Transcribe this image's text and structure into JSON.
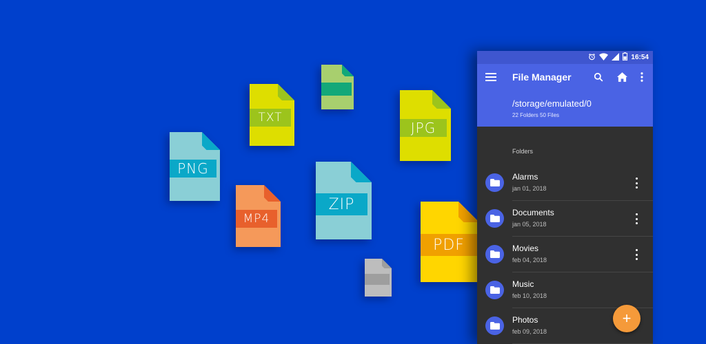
{
  "background_color": "#0040cc",
  "file_icons": [
    {
      "label": "PNG",
      "sheet": "#8acfd6",
      "accent": "#0aa8c8"
    },
    {
      "label": "TXT",
      "sheet": "#dede00",
      "accent": "#9cc41c"
    },
    {
      "label": "",
      "sheet": "#a8cf6e",
      "accent": "#13a879"
    },
    {
      "label": "JPG",
      "sheet": "#dede00",
      "accent": "#9cc41c"
    },
    {
      "label": "MP4",
      "sheet": "#f5995a",
      "accent": "#e8602c"
    },
    {
      "label": "ZIP",
      "sheet": "#8acfd6",
      "accent": "#0aa8c8"
    },
    {
      "label": "PDF",
      "sheet": "#ffd600",
      "accent": "#f0a000"
    },
    {
      "label": "",
      "sheet": "#bdbdbd",
      "accent": "#9e9e9e"
    }
  ],
  "status_bar": {
    "icons": [
      "alarm-icon",
      "wifi-icon",
      "signal-icon",
      "battery-icon"
    ],
    "time": "16:54"
  },
  "app_bar": {
    "title": "File Manager",
    "actions": [
      "search-icon",
      "home-icon",
      "more-vert-icon"
    ],
    "path": "/storage/emulated/0",
    "summary": "22 Folders 50 Files",
    "color": "#4a63e4"
  },
  "list": {
    "section_label": "Folders",
    "items": [
      {
        "name": "Alarms",
        "date": "jan 01, 2018",
        "has_menu": true
      },
      {
        "name": "Documents",
        "date": "jan 05, 2018",
        "has_menu": true
      },
      {
        "name": "Movies",
        "date": "feb 04, 2018",
        "has_menu": true
      },
      {
        "name": "Music",
        "date": "feb 10, 2018",
        "has_menu": false
      },
      {
        "name": "Photos",
        "date": "feb 09, 2018",
        "has_menu": false
      }
    ]
  },
  "fab": {
    "label": "+",
    "color": "#f59a3a"
  }
}
